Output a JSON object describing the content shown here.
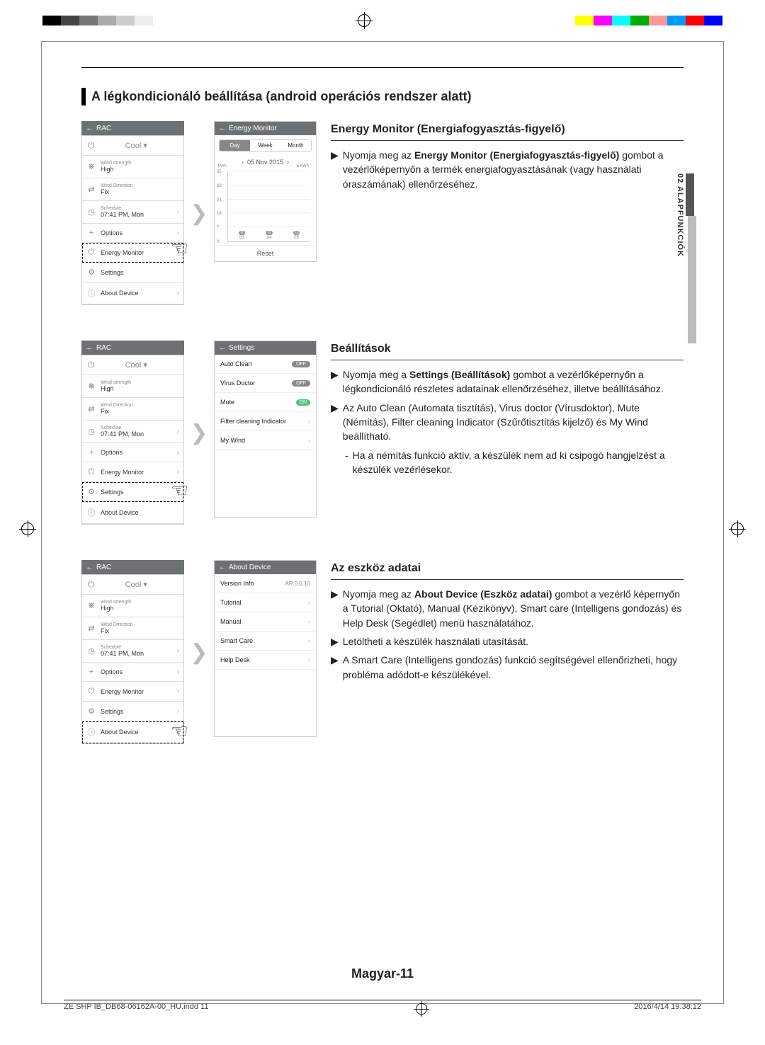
{
  "page": {
    "mainHeading": "A légkondicionáló beállítása (android operációs rendszer alatt)",
    "sideTab": "02  ALAPFUNKCIÓK",
    "footerPage": "Magyar-11",
    "footerFile": "ZE SHP IB_DB68-06162A-00_HU.indd   11",
    "footerDate": "2016/4/14   19:38:12"
  },
  "rac": {
    "header": "RAC",
    "mode": "Cool",
    "items": [
      {
        "small": "Wind strength",
        "val": "High",
        "icon": "❋",
        "chev": false
      },
      {
        "small": "Wind Direction",
        "val": "Fix",
        "icon": "⇄",
        "chev": false
      },
      {
        "small": "Schedule",
        "val": "07:41 PM, Mon",
        "icon": "◷",
        "chev": true
      },
      {
        "small": "",
        "val": "Options",
        "icon": "+",
        "chev": true
      },
      {
        "small": "",
        "val": "Energy Monitor",
        "icon": "⏻",
        "chev": true
      },
      {
        "small": "",
        "val": "Settings",
        "icon": "⚙",
        "chev": true
      },
      {
        "small": "",
        "val": "About Device",
        "icon": "ⓘ",
        "chev": true
      }
    ]
  },
  "energyMonitorScreen": {
    "header": "Energy Monitor",
    "tabs": [
      "Day",
      "Week",
      "Month"
    ],
    "date": "05 Nov 2015",
    "legend": "kWh",
    "reset": "Reset"
  },
  "chart_data": {
    "type": "bar",
    "title": "Energy Monitor",
    "xlabel": "",
    "ylabel": "kWh",
    "ylim": [
      0,
      35
    ],
    "y_ticks": [
      0,
      7,
      14,
      21,
      28,
      35
    ],
    "categories": [
      "03",
      "04",
      "05"
    ],
    "values": [
      0.0,
      0.0,
      0.0
    ]
  },
  "settingsScreen": {
    "header": "Settings",
    "rows": [
      {
        "label": "Auto Clean",
        "badge": "OFF",
        "type": "pill"
      },
      {
        "label": "Virus Doctor",
        "badge": "OFF",
        "type": "pill"
      },
      {
        "label": "Mute",
        "badge": "ON",
        "type": "toggle"
      },
      {
        "label": "Filter cleaning Indicator",
        "badge": "›",
        "type": "chev"
      },
      {
        "label": "My Wind",
        "badge": "›",
        "type": "chev"
      }
    ]
  },
  "aboutScreen": {
    "header": "About Device",
    "rows": [
      {
        "label": "Version Info",
        "right": "AR.0.0.10",
        "chev": false
      },
      {
        "label": "Tutorial",
        "right": "›",
        "chev": true
      },
      {
        "label": "Manual",
        "right": "›",
        "chev": true
      },
      {
        "label": "Smart Care",
        "right": "›",
        "chev": true
      },
      {
        "label": "Help Desk",
        "right": "›",
        "chev": true
      }
    ]
  },
  "sections": {
    "energy": {
      "title": "Energy Monitor (Energiafogyasztás-figyelő)",
      "p1a": "Nyomja meg az ",
      "p1b": "Energy Monitor (Energiafogyasztás-figyelő)",
      "p1c": " gombot a vezérlőképernyőn a termék energiafogyasztásának (vagy használati óraszámának) ellenőrzéséhez."
    },
    "settings": {
      "title": "Beállítások",
      "p1a": "Nyomja meg a ",
      "p1b": "Settings (Beállítások)",
      "p1c": " gombot a vezérlőképernyőn a légkondicionáló részletes adatainak ellenőrzéséhez, illetve beállításához.",
      "p2": "Az Auto Clean (Automata tisztítás), Virus doctor (Vírusdoktor), Mute (Némítás), Filter cleaning Indicator (Szűrőtisztítás kijelző) és My Wind beállítható.",
      "sub1": "Ha a némítás funkció aktív, a készülék nem ad ki csipogó hangjelzést a készülék vezérlésekor."
    },
    "about": {
      "title": "Az eszköz adatai",
      "p1a": "Nyomja meg az ",
      "p1b": "About Device (Eszköz adatai)",
      "p1c": " gombot a vezérlő képernyőn a Tutorial (Oktató), Manual (Kézikönyv), Smart care (Intelligens gondozás) és Help Desk (Segédlet) menü használatához.",
      "p2": "Letöltheti a készülék használati utasítását.",
      "p3": "A Smart Care (Intelligens gondozás) funkció segítségével ellenőrizheti, hogy probléma adódott-e készülékével."
    }
  }
}
